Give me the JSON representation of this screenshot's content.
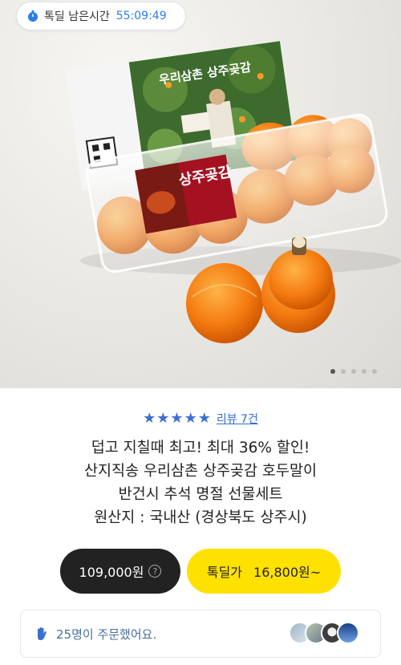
{
  "timer": {
    "label": "톡딜 남은시간",
    "value": "55:09:49"
  },
  "rating": {
    "stars": "★★★★★",
    "review_label": "리뷰 7건"
  },
  "product": {
    "title_lines": [
      "덥고 지칠때 최고! 최대 36% 할인!",
      "산지직송 우리삼촌 상주곶감 호두말이",
      "반건시 추석 명절 선물세트",
      "원산지 : 국내산 (경상북도 상주시)"
    ],
    "box_label": "상주곶감",
    "poster_label": "우리삼촌 상주곶감"
  },
  "prices": {
    "normal": "109,000원",
    "deal_label": "톡딜가",
    "deal_price": "16,800원~"
  },
  "order_info": {
    "text": "25명이 주문했어요."
  },
  "carousel": {
    "count": 5,
    "active": 0
  },
  "colors": {
    "accent_blue": "#2b7de9",
    "deal_yellow": "#ffe100",
    "dark": "#222222"
  }
}
